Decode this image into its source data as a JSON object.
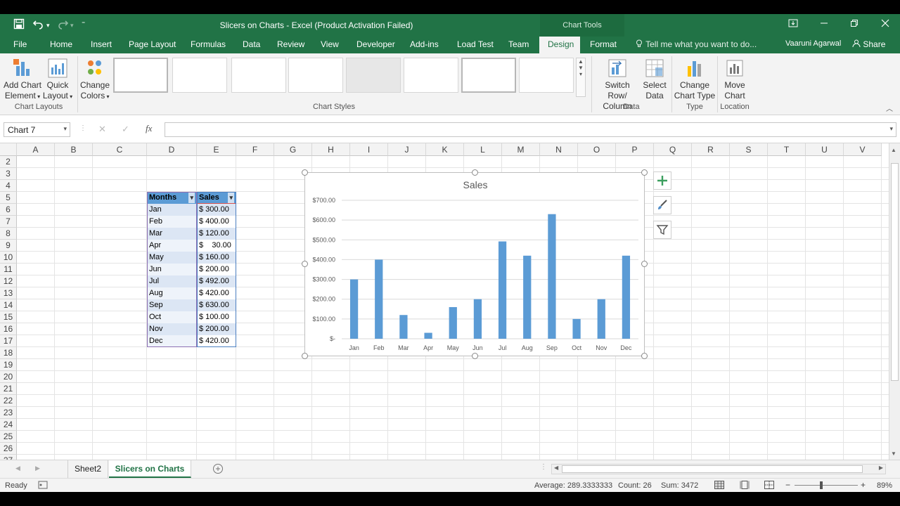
{
  "window": {
    "title": "Slicers on Charts - Excel (Product Activation Failed)",
    "context_tab_group": "Chart Tools",
    "accent_color": "#217346"
  },
  "tabs": [
    "File",
    "Home",
    "Insert",
    "Page Layout",
    "Formulas",
    "Data",
    "Review",
    "View",
    "Developer",
    "Add-ins",
    "Load Test",
    "Team",
    "Design",
    "Format"
  ],
  "active_tab": "Design",
  "tell_me": "Tell me what you want to do...",
  "user_name": "Vaaruni Agarwal",
  "share_label": "Share",
  "ribbon": {
    "add_chart_element": [
      "Add Chart",
      "Element"
    ],
    "quick_layout": [
      "Quick",
      "Layout"
    ],
    "change_colors": [
      "Change",
      "Colors"
    ],
    "switch_row_column": [
      "Switch Row/",
      "Column"
    ],
    "select_data": [
      "Select",
      "Data"
    ],
    "change_chart_type": [
      "Change",
      "Chart Type"
    ],
    "move_chart": [
      "Move",
      "Chart"
    ],
    "group_chart_layouts": "Chart Layouts",
    "group_chart_styles": "Chart Styles",
    "group_data": "Data",
    "group_type": "Type",
    "group_location": "Location"
  },
  "name_box": "Chart 7",
  "fx_label": "fx",
  "columns": [
    "A",
    "B",
    "C",
    "D",
    "E",
    "F",
    "G",
    "H",
    "I",
    "J",
    "K",
    "L",
    "M",
    "N",
    "O",
    "P",
    "Q",
    "R",
    "S",
    "T",
    "U",
    "V"
  ],
  "rows": [
    "2",
    "3",
    "4",
    "5",
    "6",
    "7",
    "8",
    "9",
    "10",
    "11",
    "12",
    "13",
    "14",
    "15",
    "16",
    "17",
    "18",
    "19",
    "20",
    "21",
    "22",
    "23",
    "24",
    "25",
    "26",
    "27"
  ],
  "table": {
    "header_months": "Months",
    "header_sales": "Sales",
    "months": [
      "Jan",
      "Feb",
      "Mar",
      "Apr",
      "May",
      "Jun",
      "Jul",
      "Aug",
      "Sep",
      "Oct",
      "Nov",
      "Dec"
    ],
    "sales": [
      "$ 300.00",
      "$ 400.00",
      "$ 120.00",
      "$    30.00",
      "$ 160.00",
      "$ 200.00",
      "$ 492.00",
      "$ 420.00",
      "$ 630.00",
      "$ 100.00",
      "$ 200.00",
      "$ 420.00"
    ]
  },
  "chart_data": {
    "type": "bar",
    "title": "Sales",
    "categories": [
      "Jan",
      "Feb",
      "Mar",
      "Apr",
      "May",
      "Jun",
      "Jul",
      "Aug",
      "Sep",
      "Oct",
      "Nov",
      "Dec"
    ],
    "values": [
      300,
      400,
      120,
      30,
      160,
      200,
      492,
      420,
      630,
      100,
      200,
      420
    ],
    "ylim": [
      0,
      700
    ],
    "yticks": [
      "$-",
      "$100.00",
      "$200.00",
      "$300.00",
      "$400.00",
      "$500.00",
      "$600.00",
      "$700.00"
    ],
    "grid": true,
    "bar_color": "#5b9bd5"
  },
  "sheet_tabs": [
    "Sheet2",
    "Slicers on Charts"
  ],
  "active_sheet": "Slicers on Charts",
  "status": {
    "ready": "Ready",
    "average": "Average: 289.3333333",
    "count": "Count: 26",
    "sum": "Sum: 3472",
    "zoom": "89%"
  }
}
